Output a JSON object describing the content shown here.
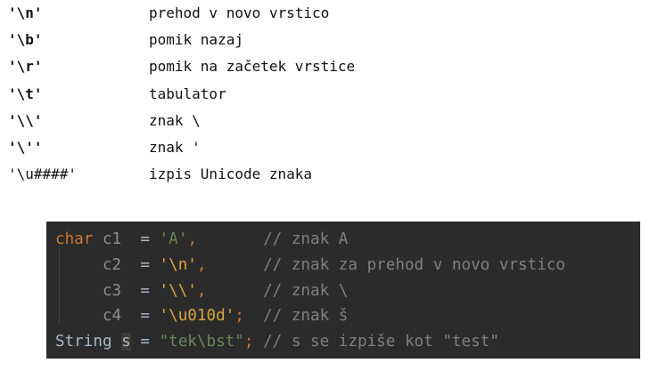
{
  "escapes": [
    {
      "code": "'\\n'",
      "desc": "prehod v novo vrstico",
      "bold": true
    },
    {
      "code": "'\\b'",
      "desc": "pomik nazaj",
      "bold": true
    },
    {
      "code": "'\\r'",
      "desc": "pomik na začetek vrstice",
      "bold": true
    },
    {
      "code": "'\\t'",
      "desc": "tabulator",
      "bold": true
    },
    {
      "code": "'\\\\'",
      "desc": "znak \\",
      "bold": true
    },
    {
      "code": "'\\''",
      "desc": "znak '",
      "bold": true
    },
    {
      "code": "'\\u####'",
      "desc": "izpis Unicode znaka",
      "bold": false
    }
  ],
  "code": {
    "line1": {
      "kw": "char",
      "var": "c1",
      "eq": " = ",
      "val": "'A'",
      "sep": ",",
      "pad": "       ",
      "comment": "// znak A"
    },
    "line2": {
      "var": "c2",
      "eq": " = ",
      "val": "'\\n'",
      "sep": ",",
      "pad": "      ",
      "comment": "// znak za prehod v novo vrstico"
    },
    "line3": {
      "var": "c3",
      "eq": " = ",
      "val": "'\\\\'",
      "sep": ",",
      "pad": "      ",
      "comment": "// znak \\"
    },
    "line4": {
      "var": "c4",
      "eq": " = ",
      "val": "'\\u010d'",
      "sep": ";",
      "pad": "  ",
      "comment": "// znak š"
    },
    "line5": {
      "type": "String",
      "var": "s",
      "eq": " = ",
      "val": "\"tek\\bst\"",
      "sep": ";",
      "pad": " ",
      "comment": "// s se izpiše kot \"test\""
    }
  },
  "colors": {
    "panel_bg": "#2b2b2b",
    "keyword": "#cc7832",
    "string": "#d9a441",
    "string_literal": "#6a8759",
    "comment": "#808080",
    "identifier": "#a9b7c6"
  }
}
